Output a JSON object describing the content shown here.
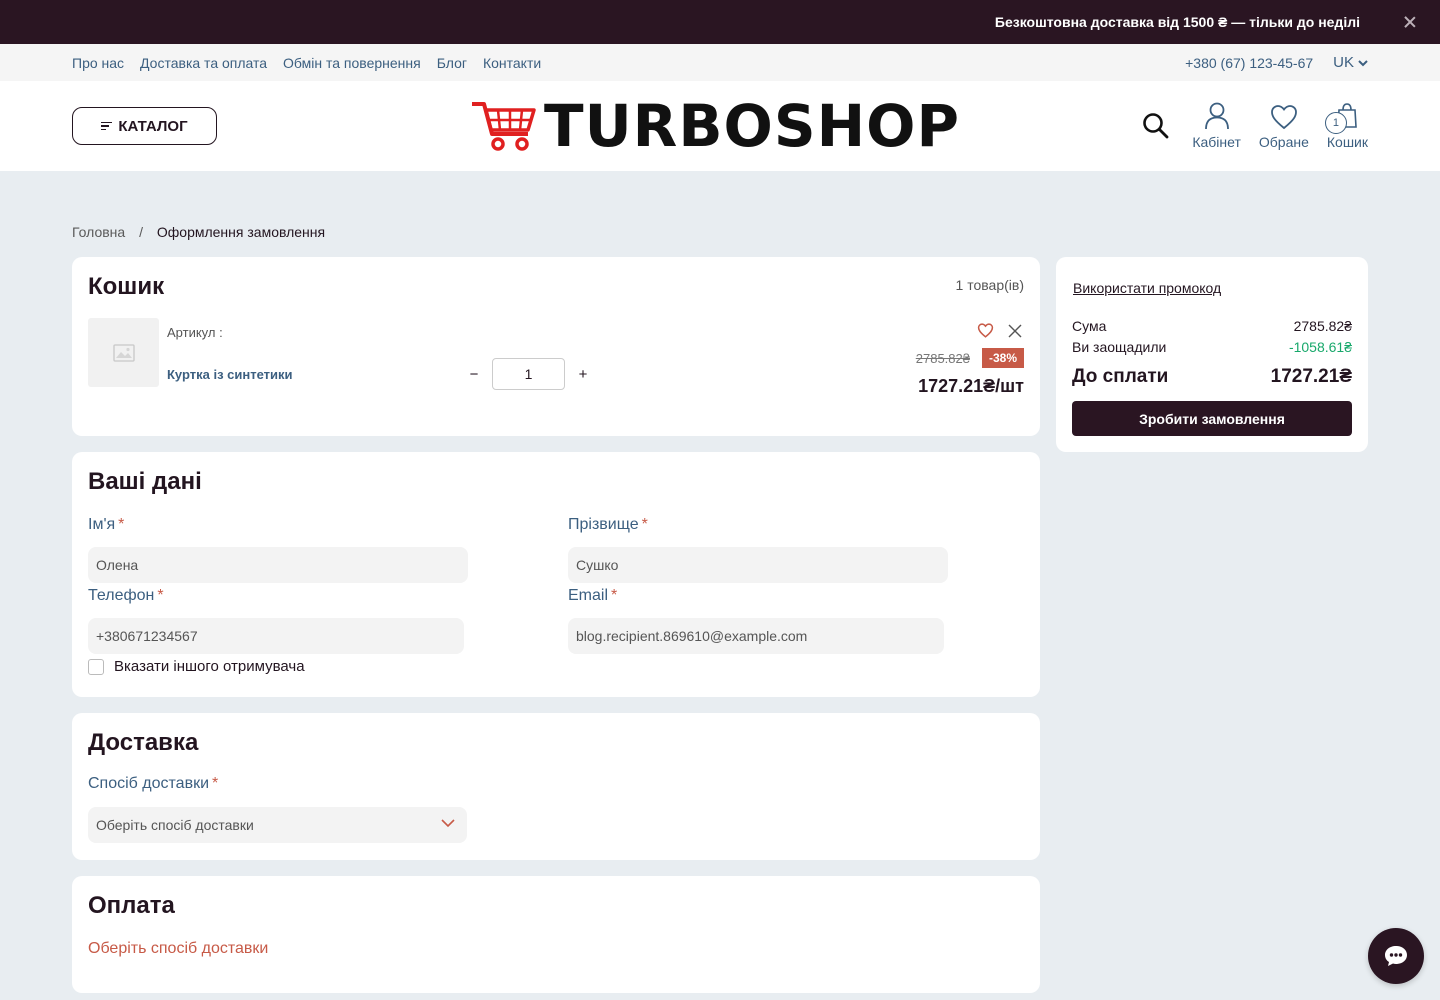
{
  "promo_bar": {
    "text": "Безкоштовна доставка від 1500 ₴ — тільки до неділі"
  },
  "topnav": {
    "links": [
      "Про нас",
      "Доставка та оплата",
      "Обмін та повернення",
      "Блог",
      "Контакти"
    ],
    "phone": "+380 (67) 123-45-67",
    "lang": "UK"
  },
  "header": {
    "catalog_label": "КАТАЛОГ",
    "logo_text": "TURBOSHOP",
    "account_label": "Кабінет",
    "favorites_label": "Обране",
    "cart_label": "Кошик",
    "cart_count": "1"
  },
  "breadcrumb": {
    "home": "Головна",
    "separator": "/",
    "current": "Оформлення замовлення"
  },
  "cart": {
    "title": "Кошик",
    "count_text": "1 товар(ів)",
    "item": {
      "sku_label": "Артикул :",
      "name": "Куртка із синтетики",
      "qty": "1",
      "old_price": "2785.82₴",
      "discount": "-38%",
      "price": "1727.21₴/шт"
    }
  },
  "your_data": {
    "title": "Ваші дані",
    "first_name_label": "Ім'я",
    "first_name_value": "Олена",
    "last_name_label": "Прізвище",
    "last_name_value": "Сушко",
    "phone_label": "Телефон",
    "phone_value": "+380671234567",
    "email_label": "Email",
    "email_value": "blog.recipient.869610@example.com",
    "required_mark": "*",
    "other_recipient_label": "Вказати іншого отримувача"
  },
  "delivery": {
    "title": "Доставка",
    "method_label": "Спосіб доставки",
    "method_placeholder": "Оберіть спосіб доставки"
  },
  "payment": {
    "title": "Оплата",
    "note": "Оберіть спосіб доставки"
  },
  "summary": {
    "promo_link": "Використати промокод",
    "sum_label": "Сума",
    "sum_value": "2785.82₴",
    "saved_label": "Ви заощадили",
    "saved_value": "-1058.61₴",
    "total_label": "До сплати",
    "total_value": "1727.21₴",
    "order_button": "Зробити замовлення"
  },
  "colors": {
    "brand_dark": "#2a1522",
    "accent_red": "#c75a47",
    "link_blue": "#3c5f80",
    "saved_green": "#18a86b",
    "logo_red": "#e02020"
  }
}
